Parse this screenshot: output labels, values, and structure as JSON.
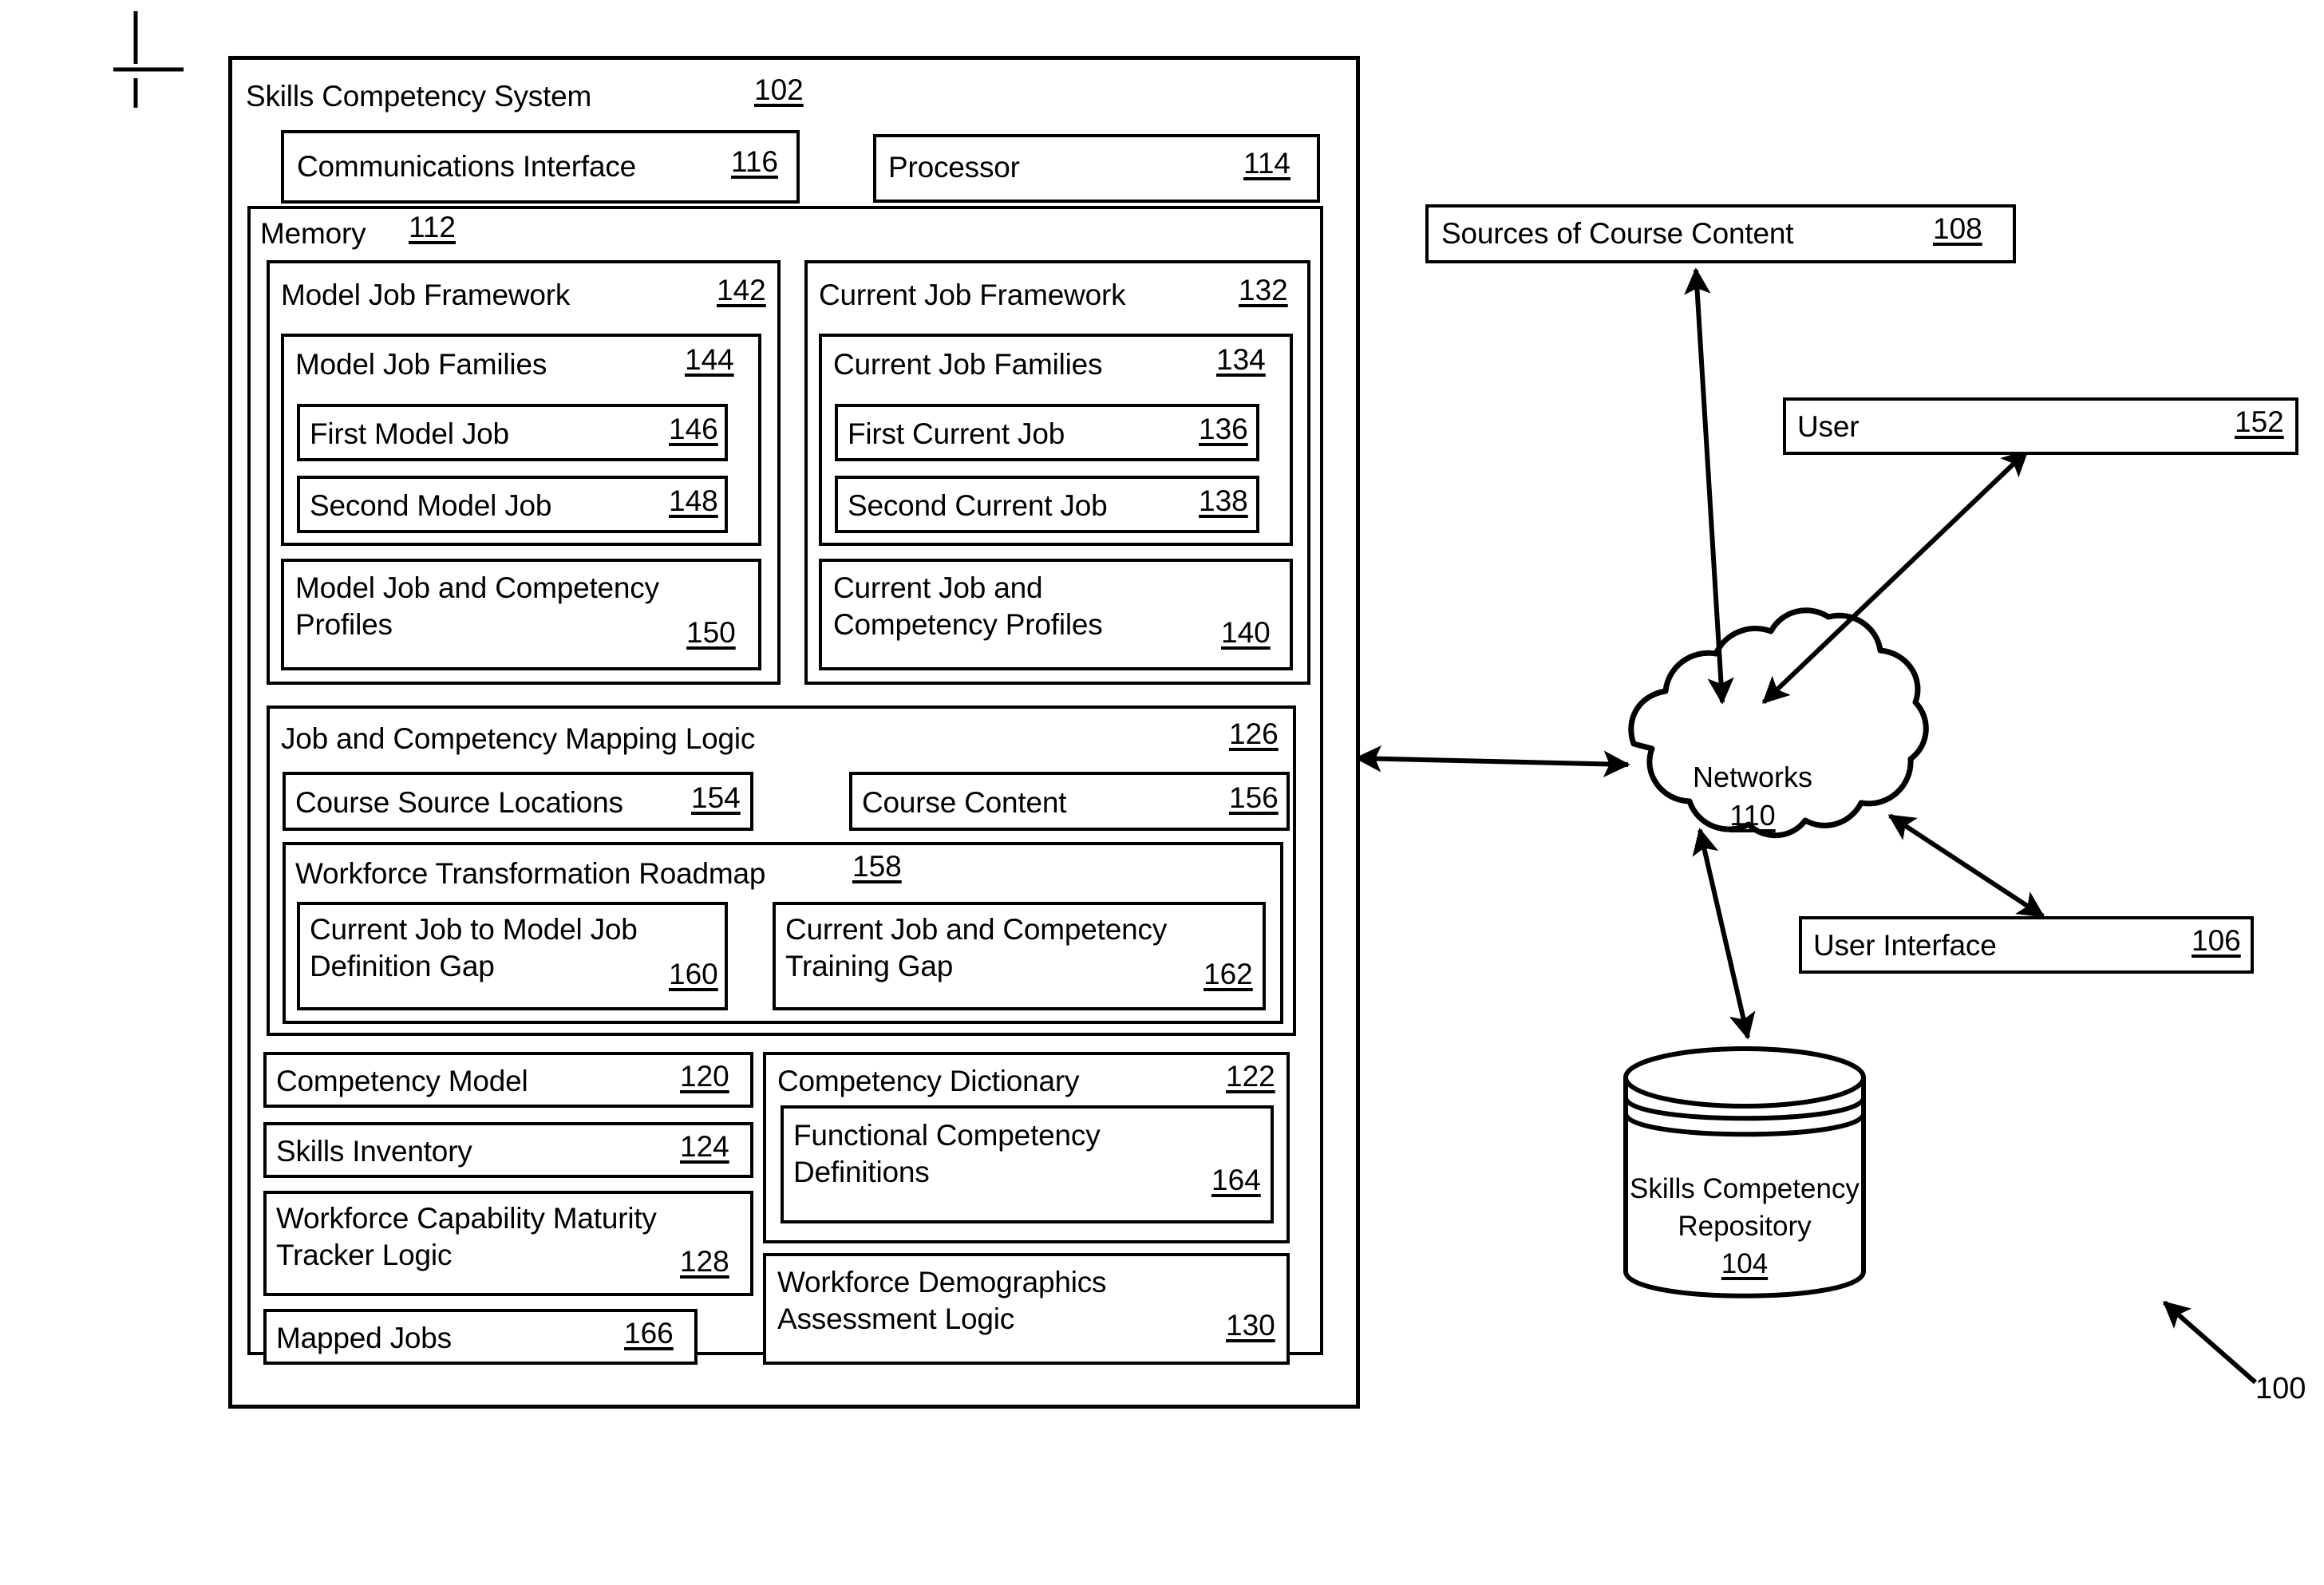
{
  "figure": {
    "number": "100",
    "registration_mark": "crosshair"
  },
  "system": {
    "title": "Skills Competency System",
    "ref": "102",
    "communications_interface": {
      "label": "Communications Interface",
      "ref": "116"
    },
    "processor": {
      "label": "Processor",
      "ref": "114"
    },
    "memory": {
      "label": "Memory",
      "ref": "112",
      "model_job_framework": {
        "label": "Model Job Framework",
        "ref": "142",
        "model_job_families": {
          "label": "Model Job Families",
          "ref": "144",
          "jobs": [
            {
              "label": "First Model Job",
              "ref": "146"
            },
            {
              "label": "Second Model Job",
              "ref": "148"
            }
          ]
        },
        "profiles": {
          "label": "Model Job and Competency Profiles",
          "ref": "150"
        }
      },
      "current_job_framework": {
        "label": "Current Job Framework",
        "ref": "132",
        "current_job_families": {
          "label": "Current Job Families",
          "ref": "134",
          "jobs": [
            {
              "label": "First Current Job",
              "ref": "136"
            },
            {
              "label": "Second Current Job",
              "ref": "138"
            }
          ]
        },
        "profiles": {
          "label": "Current Job and Competency Profiles",
          "ref": "140"
        }
      },
      "mapping_logic": {
        "label": "Job and Competency Mapping Logic",
        "ref": "126",
        "course_source_locations": {
          "label": "Course Source Locations",
          "ref": "154"
        },
        "course_content": {
          "label": "Course Content",
          "ref": "156"
        },
        "roadmap": {
          "label": "Workforce Transformation Roadmap",
          "ref": "158",
          "gaps": [
            {
              "label": "Current Job to Model Job Definition Gap",
              "ref": "160"
            },
            {
              "label": "Current Job and Competency Training Gap",
              "ref": "162"
            }
          ]
        }
      },
      "left_modules": [
        {
          "label": "Competency Model",
          "ref": "120"
        },
        {
          "label": "Skills Inventory",
          "ref": "124"
        },
        {
          "label": "Workforce Capability Maturity Tracker Logic",
          "ref": "128"
        },
        {
          "label": "Mapped Jobs",
          "ref": "166"
        }
      ],
      "competency_dictionary": {
        "label": "Competency Dictionary",
        "ref": "122",
        "functional_competency_definitions": {
          "label": "Functional Competency Definitions",
          "ref": "164"
        }
      },
      "workforce_demographics": {
        "label": "Workforce Demographics Assessment Logic",
        "ref": "130"
      }
    }
  },
  "external": {
    "sources_of_course_content": {
      "label": "Sources of Course Content",
      "ref": "108"
    },
    "user": {
      "label": "User",
      "ref": "152"
    },
    "user_interface": {
      "label": "User Interface",
      "ref": "106"
    },
    "networks": {
      "label": "Networks",
      "ref": "110"
    },
    "repository": {
      "line1": "Skills Competency",
      "line2": "Repository",
      "ref": "104"
    }
  }
}
